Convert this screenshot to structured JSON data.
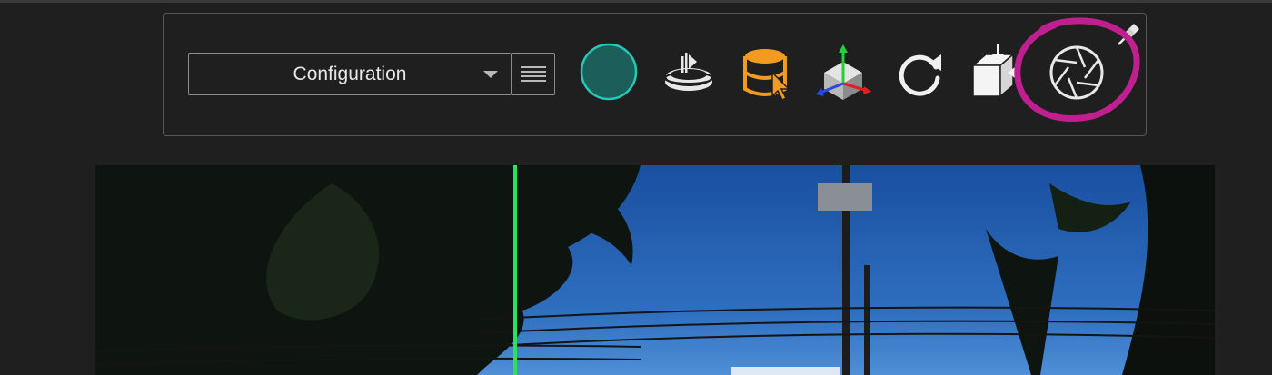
{
  "toolbar": {
    "dropdown": {
      "selected": "Configuration"
    },
    "menu_icon": "list-icon",
    "tools": [
      {
        "name": "record-button",
        "icon": "circle-icon",
        "color": "#1c5f5a"
      },
      {
        "name": "sound-source-tool",
        "icon": "disc-audio-icon"
      },
      {
        "name": "select-region-tool",
        "icon": "cylinder-cursor-icon",
        "color": "#f39a21"
      },
      {
        "name": "transform-gizmo-tool",
        "icon": "axes-cube-icon"
      },
      {
        "name": "refresh-button",
        "icon": "refresh-icon"
      },
      {
        "name": "export-box-button",
        "icon": "box-download-icon"
      },
      {
        "name": "camera-aperture-button",
        "icon": "aperture-icon"
      }
    ],
    "pin_icon": "pin-icon",
    "highlight_color": "#c0208f"
  },
  "viewport": {
    "content": "photo-preview",
    "guide_color": "#2ee05a"
  }
}
